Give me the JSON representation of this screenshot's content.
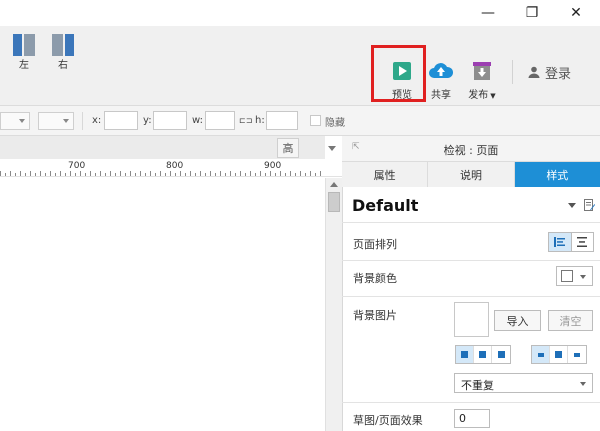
{
  "toolbar": {
    "align_left_label": "左",
    "align_right_label": "右",
    "preview_label": "预览",
    "share_label": "共享",
    "publish_label": "发布",
    "publish_caret": "▼",
    "login_label": "登录"
  },
  "window_controls": {
    "minimize": "—",
    "maximize": "❐",
    "close": "✕"
  },
  "propbar": {
    "x_label": "x:",
    "y_label": "y:",
    "w_label": "w:",
    "lock_icon": "⊏⊐",
    "h_label": "h:",
    "hide_label": "隐藏"
  },
  "ruler": {
    "labels": [
      "700",
      "800",
      "900"
    ],
    "height_button": "高"
  },
  "inspector": {
    "title": "检视 : 页面",
    "tabs": [
      {
        "label": "属性",
        "active": false
      },
      {
        "label": "说明",
        "active": false
      },
      {
        "label": "样式",
        "active": true
      }
    ],
    "page_style_name": "Default",
    "page_arrange_label": "页面排列",
    "bg_color_label": "背景颜色",
    "bg_image_label": "背景图片",
    "import_button": "导入",
    "clear_button": "清空",
    "repeat_value": "不重复",
    "sketch_effect_label": "草图/页面效果",
    "sketch_effect_value": "0"
  },
  "colors": {
    "active_tab": "#1e8fd6",
    "highlight_box": "#e02020",
    "preview_icon": "#2ea88a",
    "share_icon": "#1e8fd6",
    "publish_icon": "#9c3fb1",
    "align_bar": "#3b76ba"
  }
}
